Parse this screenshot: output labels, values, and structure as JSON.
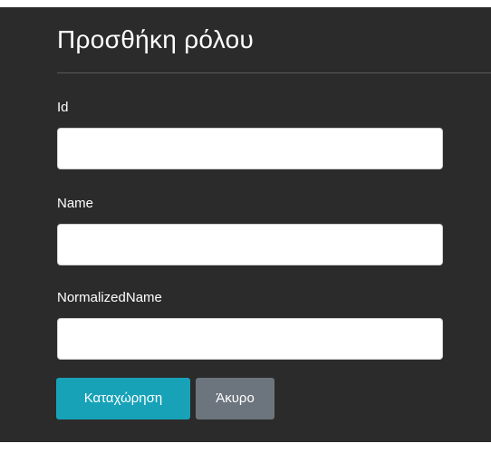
{
  "form": {
    "title": "Προσθήκη ρόλου",
    "fields": [
      {
        "label": "Id",
        "value": "",
        "placeholder": ""
      },
      {
        "label": "Name",
        "value": "",
        "placeholder": ""
      },
      {
        "label": "NormalizedName",
        "value": "",
        "placeholder": ""
      }
    ],
    "submit_label": "Καταχώρηση",
    "cancel_label": "Άκυρο"
  },
  "colors": {
    "panel_background": "#2b2b2b",
    "primary_button": "#17a2b8",
    "secondary_button": "#6c757d"
  }
}
